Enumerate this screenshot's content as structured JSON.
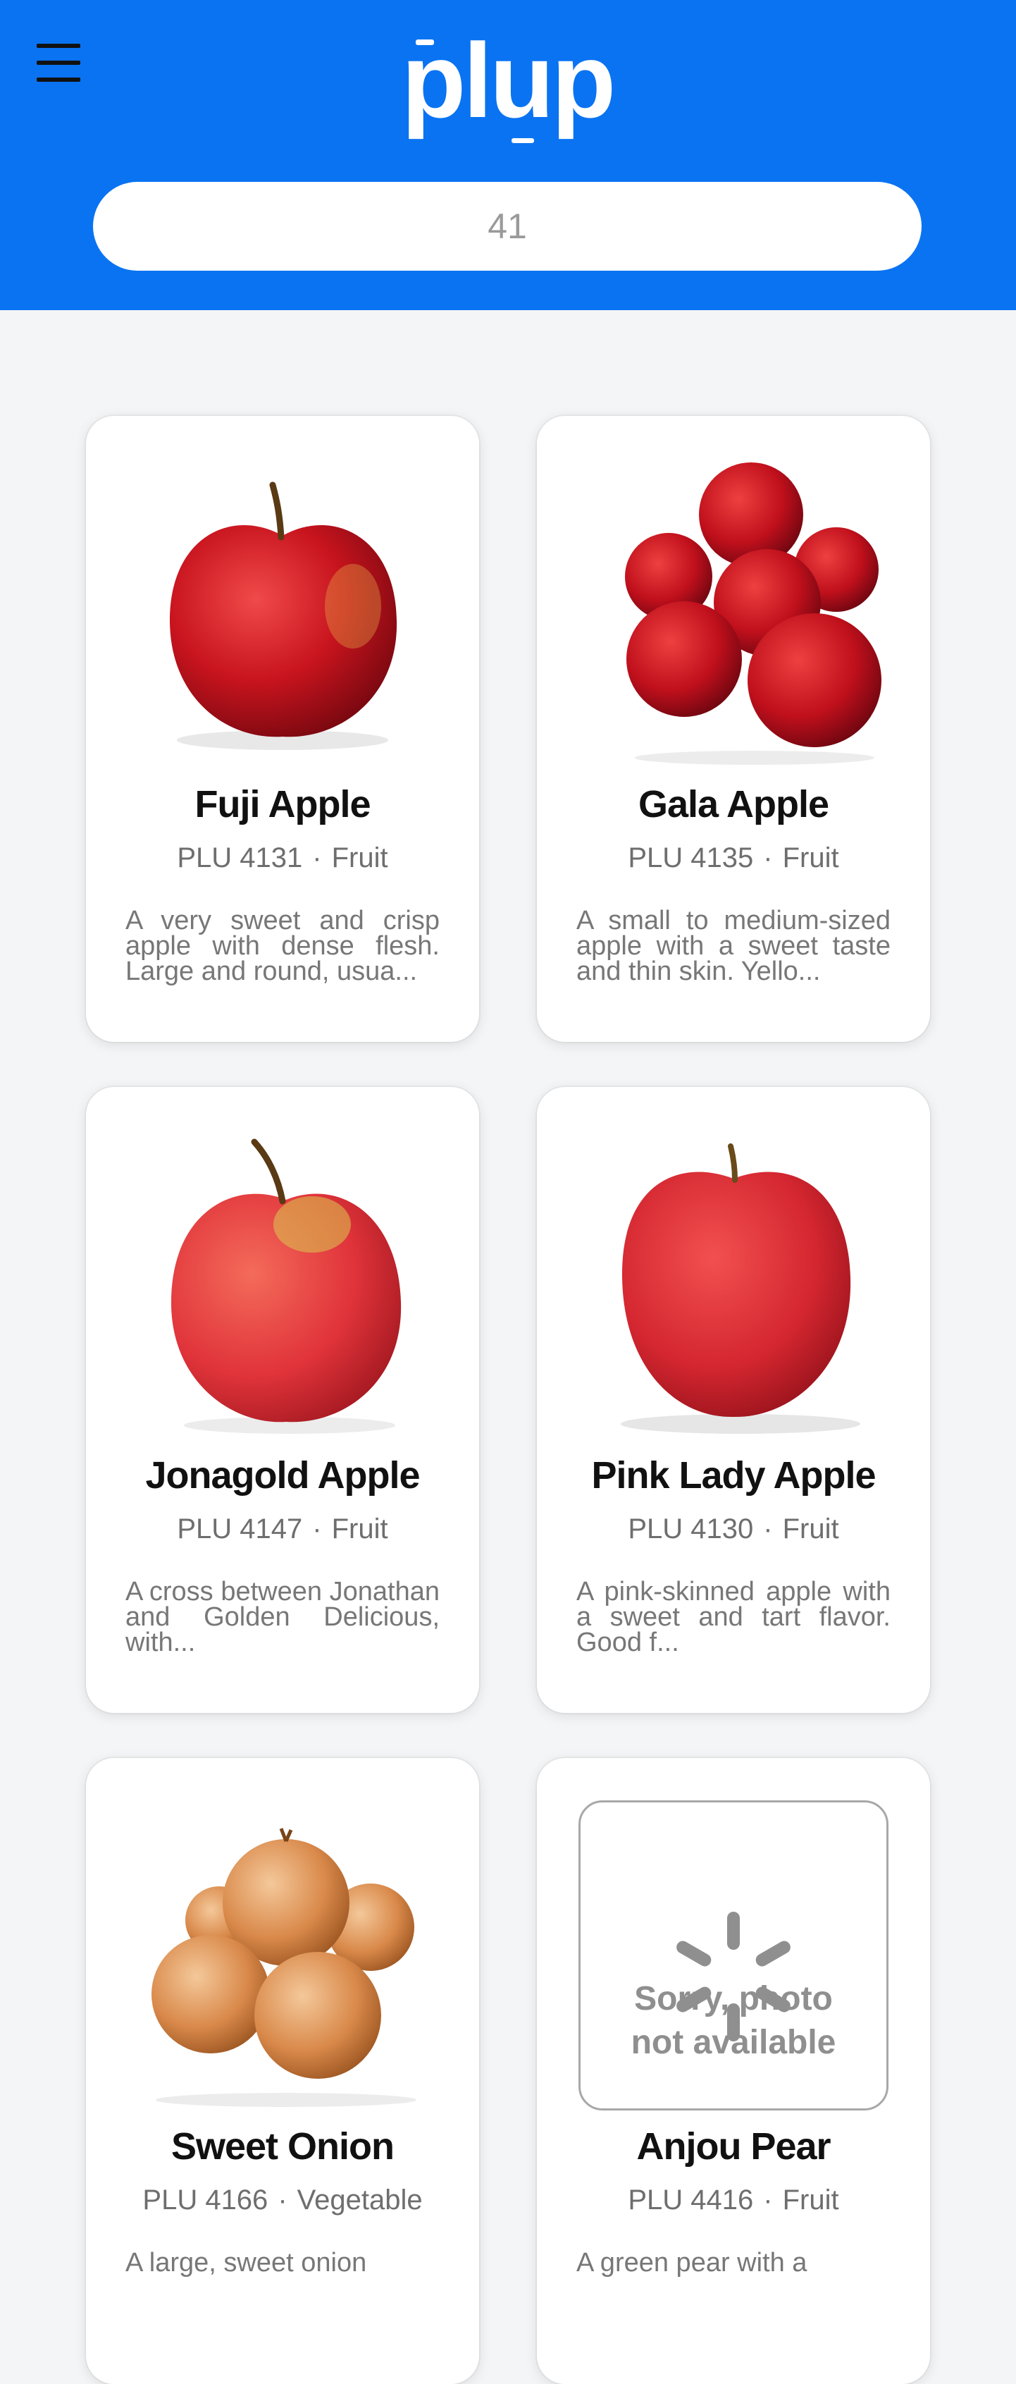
{
  "header": {
    "logo_text": "plup",
    "search": {
      "value": "41",
      "placeholder": ""
    },
    "brand_color": "#0a73f2",
    "menu_icon": "hamburger-menu-icon"
  },
  "products": [
    {
      "name": "Fuji Apple",
      "plu": "PLU 4131",
      "separator": "·",
      "category": "Fruit",
      "description": "A very sweet and crisp apple with dense flesh. Large and round, usua...",
      "photo": "fuji-apple-photo"
    },
    {
      "name": "Gala Apple",
      "plu": "PLU 4135",
      "separator": "·",
      "category": "Fruit",
      "description": "A small to medium-sized apple with a sweet taste and thin skin. Yello...",
      "photo": "gala-apples-photo"
    },
    {
      "name": "Jonagold Apple",
      "plu": "PLU 4147",
      "separator": "·",
      "category": "Fruit",
      "description": "A cross between Jonathan and Golden Delicious, with...",
      "photo": "jonagold-apple-photo"
    },
    {
      "name": "Pink Lady Apple",
      "plu": "PLU 4130",
      "separator": "·",
      "category": "Fruit",
      "description": "A pink-skinned apple with a sweet and tart flavor. Good f...",
      "photo": "pink-lady-apple-photo"
    },
    {
      "name": "Sweet Onion",
      "plu": "PLU 4166",
      "separator": "·",
      "category": "Vegetable",
      "description": "A large, sweet onion",
      "photo": "sweet-onions-photo"
    },
    {
      "name": "Anjou Pear",
      "plu": "PLU 4416",
      "separator": "·",
      "category": "Fruit",
      "description": "A green pear with a",
      "photo": "photo-unavailable-placeholder",
      "photo_placeholder": {
        "line1": "Sorry, photo",
        "line2": "not available"
      }
    }
  ]
}
